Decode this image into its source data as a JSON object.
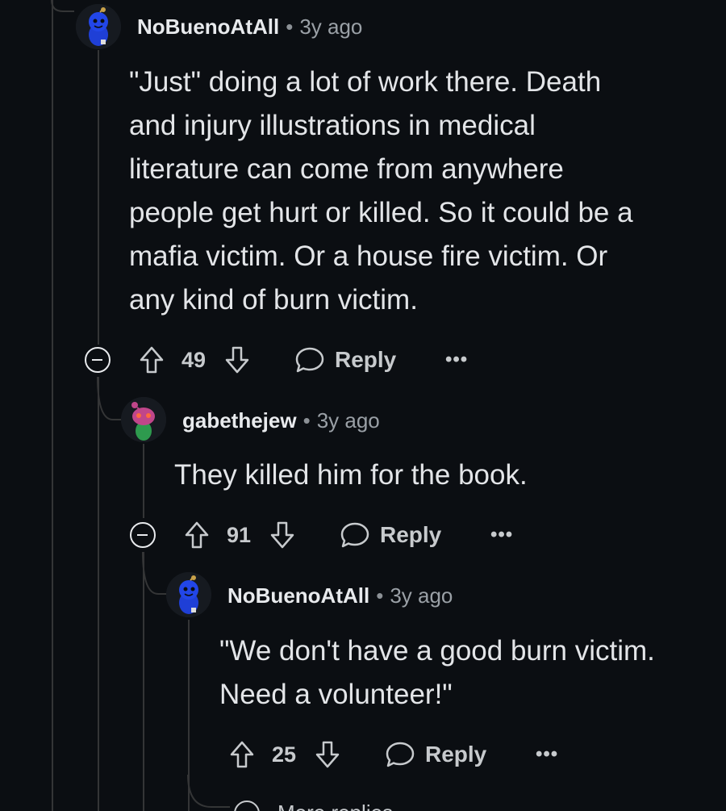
{
  "comments": [
    {
      "username": "NoBuenoAtAll",
      "separator": "•",
      "time": "3y ago",
      "avatar_icon": "snoo-blue-avatar-icon",
      "body_lines": [
        "\"Just\" doing a lot of work there. Death",
        "and injury illustrations in medical",
        "literature can come from anywhere",
        "people get hurt or killed. So it could be a",
        "mafia victim. Or a house fire victim. Or",
        "any kind of burn victim."
      ],
      "votes": "49",
      "reply_label": "Reply",
      "more_label": "•••"
    },
    {
      "username": "gabethejew",
      "separator": "•",
      "time": "3y ago",
      "avatar_icon": "snoo-pink-avatar-icon",
      "body_lines": [
        "They killed him for the book."
      ],
      "votes": "91",
      "reply_label": "Reply",
      "more_label": "•••"
    },
    {
      "username": "NoBuenoAtAll",
      "separator": "•",
      "time": "3y ago",
      "avatar_icon": "snoo-blue-avatar-icon",
      "body_lines": [
        "\"We don't have a good burn victim.",
        "Need a volunteer!\""
      ],
      "votes": "25",
      "reply_label": "Reply",
      "more_label": "•••"
    }
  ],
  "more_replies_label": "More replies",
  "colors": {
    "background": "#0b0e12",
    "thread_line": "#343536",
    "text": "#e3e5e8",
    "muted": "#9aa0a6",
    "avatar_blue": "#1f3fd6",
    "avatar_pink": "#c0468a"
  }
}
